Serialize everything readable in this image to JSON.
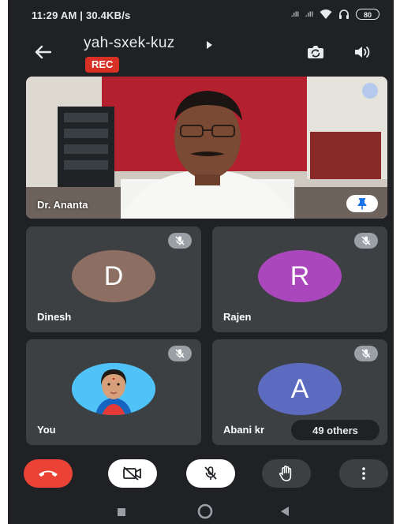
{
  "status_bar": {
    "time_speed": "11:29 AM | 30.4KB/s",
    "signal_1": ".ıll",
    "signal_2": ".ıll",
    "battery": "80"
  },
  "header": {
    "meeting_code": "yah-sxek-kuz",
    "rec_label": "REC"
  },
  "main_video": {
    "participant_name": "Dr. Ananta"
  },
  "participants": [
    {
      "name": "Dinesh",
      "initial": "D",
      "color": "#8d6e63"
    },
    {
      "name": "Rajen",
      "initial": "R",
      "color": "#ab47bc"
    },
    {
      "name": "You",
      "initial": "",
      "color": "#4fc3f7"
    },
    {
      "name": "Abani kr",
      "initial": "A",
      "color": "#5c6bc0"
    }
  ],
  "others_label": "49 others",
  "colors": {
    "background": "#202124",
    "tile": "#3c4043",
    "end_call": "#ea4335",
    "rec": "#d93025"
  },
  "icons": [
    "back-arrow-icon",
    "camera-switch-icon",
    "speaker-icon",
    "pin-icon",
    "mic-off-icon",
    "end-call-icon",
    "video-off-icon",
    "raise-hand-icon",
    "more-vert-icon"
  ]
}
